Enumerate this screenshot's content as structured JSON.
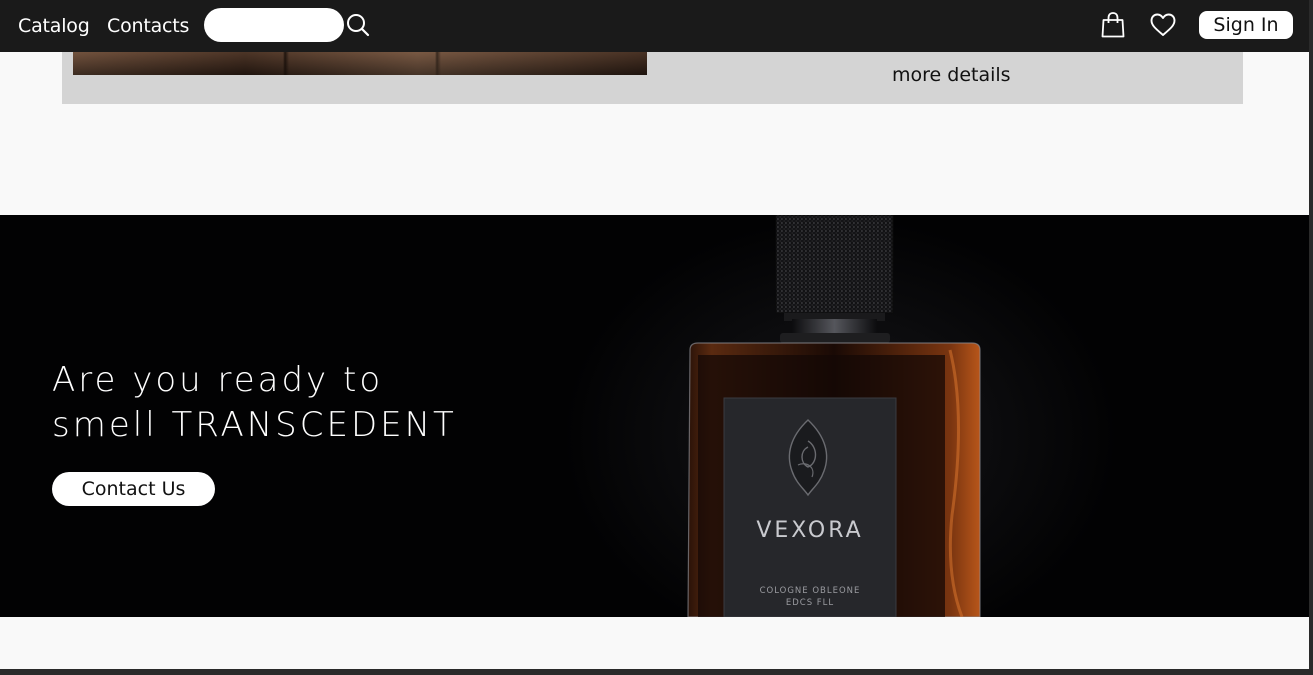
{
  "nav": {
    "links": [
      "Catalog",
      "Contacts"
    ],
    "search_placeholder": "",
    "search_icon": "search-icon",
    "cart_icon": "shopping-bag-icon",
    "wishlist_icon": "heart-icon",
    "sign_in_label": "Sign In"
  },
  "product_card": {
    "details_link": "more details"
  },
  "hero": {
    "title_line1": "Are you ready to",
    "title_line2": "smell TRANSCEDENT",
    "cta_label": "Contact Us",
    "bottle": {
      "brand": "VEXORA",
      "label_line1": "COLOGNE OBLEONE",
      "label_line2": "EDCS FLL"
    }
  },
  "colors": {
    "nav_background": "#1a1a1a",
    "hero_background": "#020203",
    "card_background": "#d4d4d4",
    "page_background": "#f9f9f9"
  }
}
